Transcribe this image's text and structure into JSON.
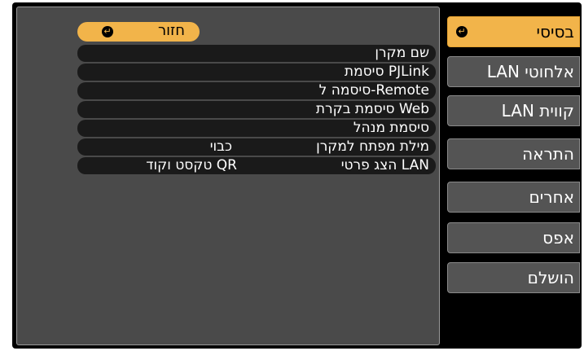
{
  "back_button": {
    "label": "חזור",
    "icon": "enter-icon"
  },
  "tabs": [
    {
      "label": "בסיסי",
      "active": true,
      "icon": "enter-icon"
    },
    {
      "label": "LAN אלחוטי",
      "active": false
    },
    {
      "label": "LAN קווית",
      "active": false
    },
    {
      "label": "התראה",
      "active": false
    },
    {
      "label": "אחרים",
      "active": false
    },
    {
      "label": "אפס",
      "active": false
    },
    {
      "label": "הושלם",
      "active": false
    }
  ],
  "settings": [
    {
      "label": "שם מקרן",
      "value": ""
    },
    {
      "label": "סיסמת PJLink",
      "value": ""
    },
    {
      "label": "סיסמה ל-Remote",
      "value": ""
    },
    {
      "label": "סיסמת בקרת Web",
      "value": ""
    },
    {
      "label": "סיסמת מנהל",
      "value": ""
    },
    {
      "label": "מילת מפתח למקרן",
      "value": "כבוי"
    },
    {
      "label": "הצג פרטי LAN",
      "value": "טקסט וקוד QR"
    }
  ],
  "colors": {
    "accent": "#f2b44a",
    "panel": "#4a4a4a",
    "row": "#1a1a1a"
  }
}
